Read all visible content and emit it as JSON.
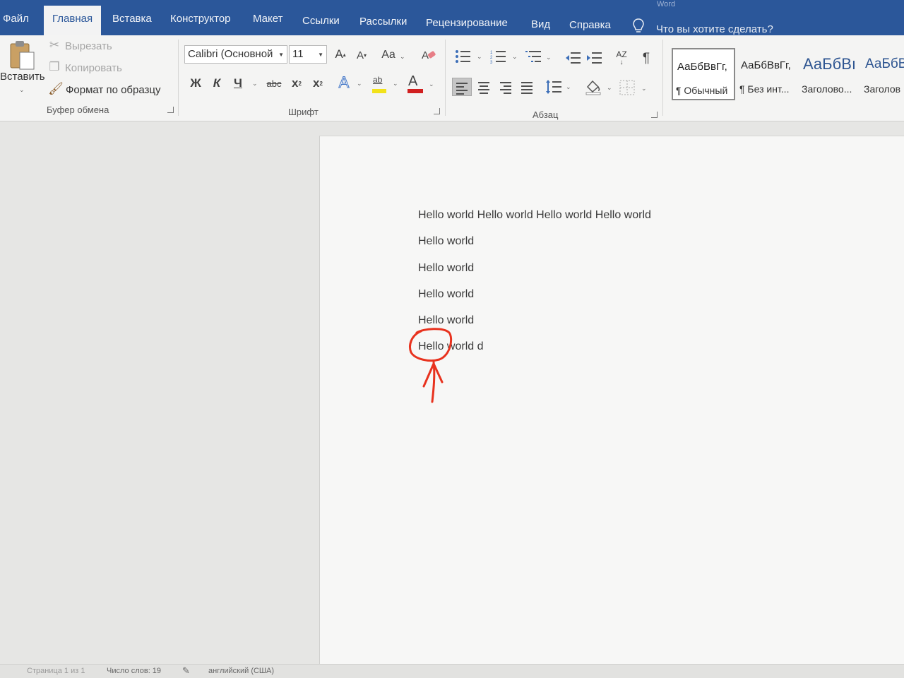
{
  "title_bar": {
    "app_name": "Word"
  },
  "tabs": [
    {
      "label": "Файл"
    },
    {
      "label": "Главная"
    },
    {
      "label": "Вставка"
    },
    {
      "label": "Конструктор"
    },
    {
      "label": "Макет"
    },
    {
      "label": "Ссылки"
    },
    {
      "label": "Рассылки"
    },
    {
      "label": "Рецензирование"
    },
    {
      "label": "Вид"
    },
    {
      "label": "Справка"
    }
  ],
  "active_tab": "Главная",
  "tell_me": {
    "text": "Что вы хотите сделать?",
    "icon": "lightbulb-icon"
  },
  "clipboard": {
    "paste_label": "Вставить",
    "cut_label": "Вырезать",
    "copy_label": "Копировать",
    "format_painter_label": "Формат по образцу",
    "group_label": "Буфер обмена"
  },
  "font": {
    "family": "Calibri (Основной",
    "size": "11",
    "change_case": "Aa",
    "bold": "Ж",
    "italic": "К",
    "underline": "Ч",
    "strikethrough": "abc",
    "subscript": "x",
    "superscript": "x",
    "highlight_letters": "ab",
    "font_color_letter": "A",
    "grow_letter": "A",
    "shrink_letter": "A",
    "text_effects_letter": "A",
    "group_label": "Шрифт"
  },
  "paragraph": {
    "group_label": "Абзац",
    "show_marks_symbol": "¶",
    "sort_label": "AZ"
  },
  "styles": [
    {
      "sample": "АаБбВвГг,",
      "name": "¶ Обычный",
      "selected": true
    },
    {
      "sample": "АаБбВвГг,",
      "name": "¶ Без инт...",
      "selected": false
    },
    {
      "sample": "АаБбВı",
      "name": "Заголово...",
      "selected": false
    },
    {
      "sample": "АаБбВ",
      "name": "Заголов",
      "selected": false
    }
  ],
  "document": {
    "lines": [
      "Hello world Hello world Hello world Hello world",
      "Hello world",
      "Hello world",
      "Hello world",
      "Hello world",
      "Hello world d"
    ]
  },
  "status_bar": {
    "page": "Страница 1 из 1",
    "words": "Число слов: 19",
    "proofing_icon": "proofing-icon",
    "language": "английский (США)"
  },
  "colors": {
    "brand": "#2b579a",
    "annotation": "#e8321e",
    "font_color_bar": "#d11f1f",
    "highlight_bar": "#f2e21a"
  }
}
